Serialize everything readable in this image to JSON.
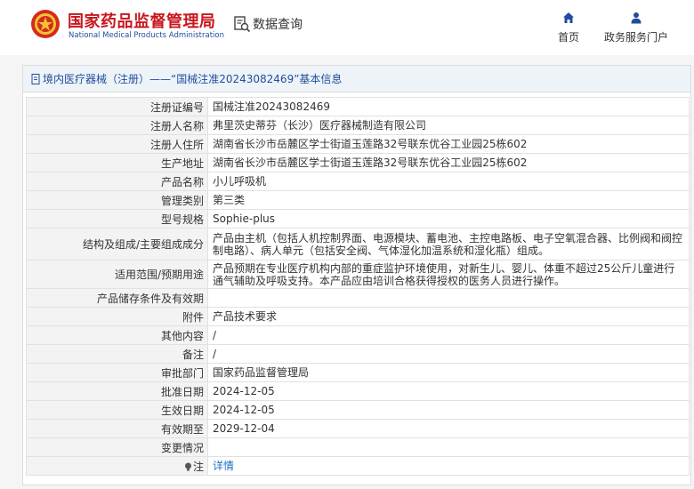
{
  "header": {
    "brand_cn": "国家药品监督管理局",
    "brand_en": "National Medical Products Administration",
    "query_label": "数据查询",
    "nav": [
      {
        "label": "首页",
        "icon": "home-icon"
      },
      {
        "label": "政务服务门户",
        "icon": "user-icon"
      }
    ]
  },
  "colors": {
    "brand_red": "#c8161d",
    "brand_blue": "#1f4e9c",
    "link_blue": "#1f6fc5",
    "label_bg": "#f3f3f3",
    "title_bg": "#eef3f8"
  },
  "panel": {
    "title": "境内医疗器械（注册）——“国械注准20243082469”基本信息"
  },
  "rows": [
    {
      "label": "注册证编号",
      "value": "国械注准20243082469"
    },
    {
      "label": "注册人名称",
      "value": "弗里茨史蒂芬（长沙）医疗器械制造有限公司"
    },
    {
      "label": "注册人住所",
      "value": "湖南省长沙市岳麓区学士街道玉莲路32号联东优谷工业园25栋602"
    },
    {
      "label": "生产地址",
      "value": "湖南省长沙市岳麓区学士街道玉莲路32号联东优谷工业园25栋602"
    },
    {
      "label": "产品名称",
      "value": "小儿呼吸机"
    },
    {
      "label": "管理类别",
      "value": "第三类"
    },
    {
      "label": "型号规格",
      "value": "Sophie-plus"
    },
    {
      "label": "结构及组成/主要组成成分",
      "value": "产品由主机（包括人机控制界面、电源模块、蓄电池、主控电路板、电子空氧混合器、比例阀和阀控制电路）、病人单元（包括安全阀、气体湿化加温系统和湿化瓶）组成。"
    },
    {
      "label": "适用范围/预期用途",
      "value": "产品预期在专业医疗机构内部的重症监护环境使用，对新生儿、婴儿、体重不超过25公斤儿童进行通气辅助及呼吸支持。本产品应由培训合格获得授权的医务人员进行操作。"
    },
    {
      "label": "产品储存条件及有效期",
      "value": ""
    },
    {
      "label": "附件",
      "value": "产品技术要求"
    },
    {
      "label": "其他内容",
      "value": "/"
    },
    {
      "label": "备注",
      "value": "/"
    },
    {
      "label": "审批部门",
      "value": "国家药品监督管理局"
    },
    {
      "label": "批准日期",
      "value": "2024-12-05"
    },
    {
      "label": "生效日期",
      "value": "2024-12-05"
    },
    {
      "label": "有效期至",
      "value": "2029-12-04"
    },
    {
      "label": "变更情况",
      "value": ""
    }
  ],
  "note_row": {
    "label": "注",
    "link": "详情"
  }
}
